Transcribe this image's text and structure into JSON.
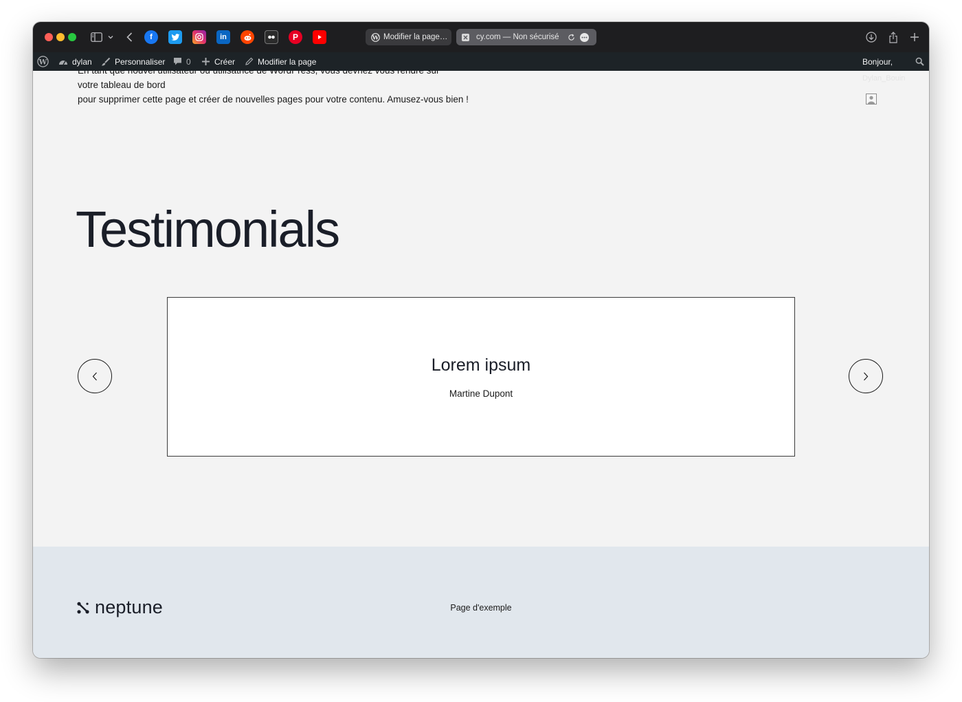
{
  "colors": {
    "toolbar_bg": "#1e1e20",
    "adminbar_bg": "#1d2327",
    "content_bg": "#f3f3f3",
    "footer_bg": "#e1e7ed",
    "traffic_close": "#ff5f57",
    "traffic_min": "#febc2e",
    "traffic_max": "#28c840"
  },
  "browser": {
    "bookmarks": [
      {
        "icon": "facebook-icon",
        "color": "#1877f2"
      },
      {
        "icon": "twitter-icon",
        "color": "#1d9bf0"
      },
      {
        "icon": "instagram-icon",
        "color": "#e1306c"
      },
      {
        "icon": "linkedin-icon",
        "color": "#0a66c2"
      },
      {
        "icon": "reddit-icon",
        "color": "#ff4500"
      },
      {
        "icon": "flickr-icon",
        "color": "#2b2b2b"
      },
      {
        "icon": "pinterest-icon",
        "color": "#e60023"
      },
      {
        "icon": "youtube-icon",
        "color": "#ff0000"
      }
    ],
    "tabs": [
      {
        "label": "Modifier la page…",
        "active": false
      },
      {
        "label": "cy.com — Non sécurisé",
        "active": true
      }
    ]
  },
  "adminbar": {
    "site": "dylan",
    "customize": "Personnaliser",
    "comments": "0",
    "new": "Créer",
    "edit": "Modifier la page",
    "greeting": "Bonjour,"
  },
  "content": {
    "intro_partial": "En tant que nouvel utilisateur ou utilisatrice de WordPress, vous devriez vous rendre sur",
    "intro_line2": "votre tableau de bord",
    "intro_line3": "pour supprimer cette page et créer de nouvelles pages pour votre contenu. Amusez-vous bien !",
    "faded_name": "Dylan_Bouin",
    "heading": "Testimonials",
    "testimonial": {
      "title": "Lorem ipsum",
      "author": "Martine Dupont"
    }
  },
  "footer": {
    "logo": "neptune",
    "link": "Page d'exemple"
  }
}
